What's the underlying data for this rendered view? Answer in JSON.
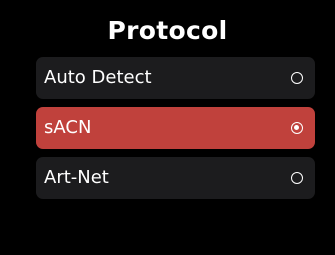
{
  "screen": {
    "title": "Protocol"
  },
  "options": [
    {
      "label": "Auto Detect",
      "selected": false
    },
    {
      "label": "sACN",
      "selected": true
    },
    {
      "label": "Art-Net",
      "selected": false
    }
  ],
  "colors": {
    "background": "#000000",
    "item_background": "#1c1c1e",
    "selected_background": "#c0413c",
    "text": "#ffffff"
  },
  "icons": {
    "radio_unselected": "radio-unselected-icon",
    "radio_selected": "radio-selected-icon"
  }
}
